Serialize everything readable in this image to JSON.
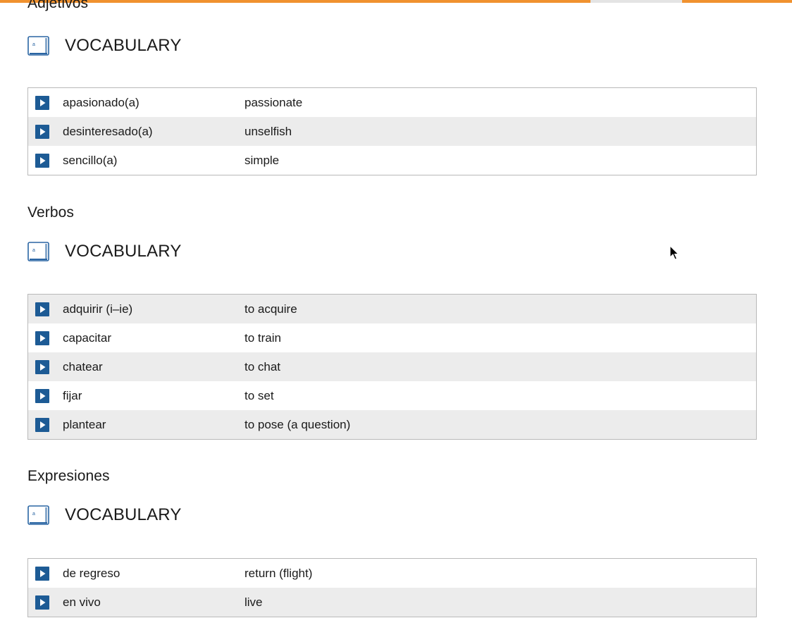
{
  "colors": {
    "accent_bar": "#f0922f",
    "play_button": "#1d5b95",
    "row_shade": "#ececec"
  },
  "icons": {
    "section_icon": "book-icon",
    "row_button": "play-icon",
    "pointer": "mouse-cursor-icon"
  },
  "sections": [
    {
      "title": "Adjetivos",
      "vocab_label": "VOCABULARY",
      "rows": [
        {
          "term": "apasionado(a)",
          "translation": "passionate"
        },
        {
          "term": "desinteresado(a)",
          "translation": "unselfish"
        },
        {
          "term": "sencillo(a)",
          "translation": "simple"
        }
      ]
    },
    {
      "title": "Verbos",
      "vocab_label": "VOCABULARY",
      "rows": [
        {
          "term": "adquirir (i–ie)",
          "translation": "to acquire"
        },
        {
          "term": "capacitar",
          "translation": "to train"
        },
        {
          "term": "chatear",
          "translation": "to chat"
        },
        {
          "term": "fijar",
          "translation": "to set"
        },
        {
          "term": "plantear",
          "translation": "to pose (a question)"
        }
      ]
    },
    {
      "title": "Expresiones",
      "vocab_label": "VOCABULARY",
      "rows": [
        {
          "term": "de regreso",
          "translation": "return (flight)"
        },
        {
          "term": "en vivo",
          "translation": "live"
        }
      ]
    }
  ]
}
